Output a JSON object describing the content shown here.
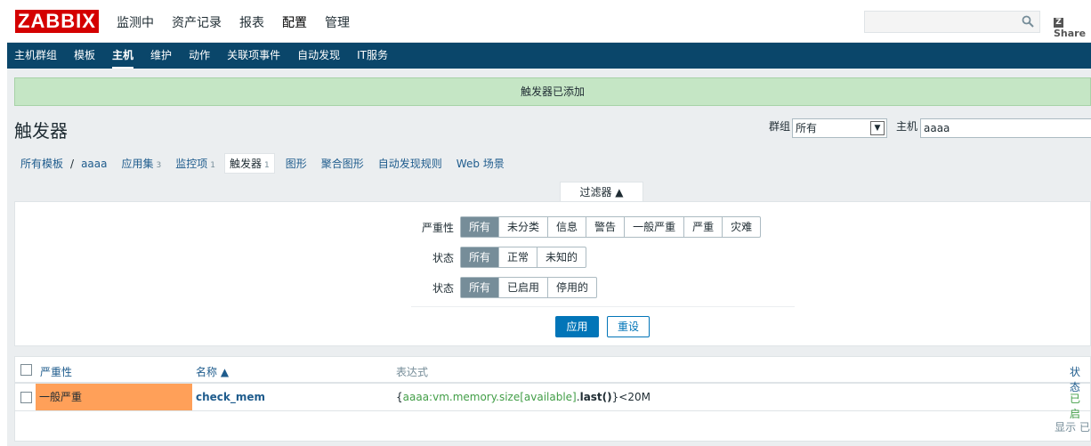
{
  "brand": {
    "logo_text": "ZABBIX",
    "accent": "#d40000",
    "nav_bg": "#0a466a"
  },
  "top_menu": [
    {
      "label": "监测中",
      "selected": false
    },
    {
      "label": "资产记录",
      "selected": false
    },
    {
      "label": "报表",
      "selected": false
    },
    {
      "label": "配置",
      "selected": true
    },
    {
      "label": "管理",
      "selected": false
    }
  ],
  "search": {
    "placeholder": ""
  },
  "share": {
    "label": "Share",
    "badge": "Z"
  },
  "sub_menu": [
    {
      "label": "主机群组"
    },
    {
      "label": "模板"
    },
    {
      "label": "主机",
      "selected": true
    },
    {
      "label": "维护"
    },
    {
      "label": "动作"
    },
    {
      "label": "关联项事件"
    },
    {
      "label": "自动发现"
    },
    {
      "label": "IT服务"
    }
  ],
  "message": "触发器已添加",
  "page_title": "触发器",
  "header_filters": {
    "group_label": "群组",
    "group_value": "所有",
    "host_label": "主机",
    "host_value": "aaaa"
  },
  "breadcrumbs": {
    "all_templates": "所有模板",
    "separator": "/",
    "host": "aaaa",
    "items": [
      {
        "label": "应用集",
        "count": "3"
      },
      {
        "label": "监控项",
        "count": "1"
      },
      {
        "label": "触发器",
        "count": "1",
        "active": true
      },
      {
        "label": "图形",
        "count": ""
      },
      {
        "label": "聚合图形",
        "count": ""
      },
      {
        "label": "自动发现规则",
        "count": ""
      },
      {
        "label": "Web 场景",
        "count": ""
      }
    ]
  },
  "filter": {
    "tab_label": "过滤器 ▲",
    "severity_label": "严重性",
    "severity_options": [
      "所有",
      "未分类",
      "信息",
      "警告",
      "一般严重",
      "严重",
      "灾难"
    ],
    "state_label": "状态",
    "state_options": [
      "所有",
      "正常",
      "未知的"
    ],
    "status_label": "状态",
    "status_options": [
      "所有",
      "已启用",
      "停用的"
    ],
    "apply_label": "应用",
    "reset_label": "重设"
  },
  "table": {
    "headers": {
      "severity": "严重性",
      "name": "名称 ▲",
      "expression": "表达式",
      "status": "状态"
    },
    "rows": [
      {
        "severity": "一般严重",
        "severity_color": "#ffa059",
        "name": "check_mem",
        "expr_open": "{",
        "expr_key": "aaaa:vm.memory.size[available]",
        "expr_dot": ".",
        "expr_func": "last()",
        "expr_close": "}<20M",
        "status": "已启"
      }
    ],
    "footer": "显示 已"
  }
}
